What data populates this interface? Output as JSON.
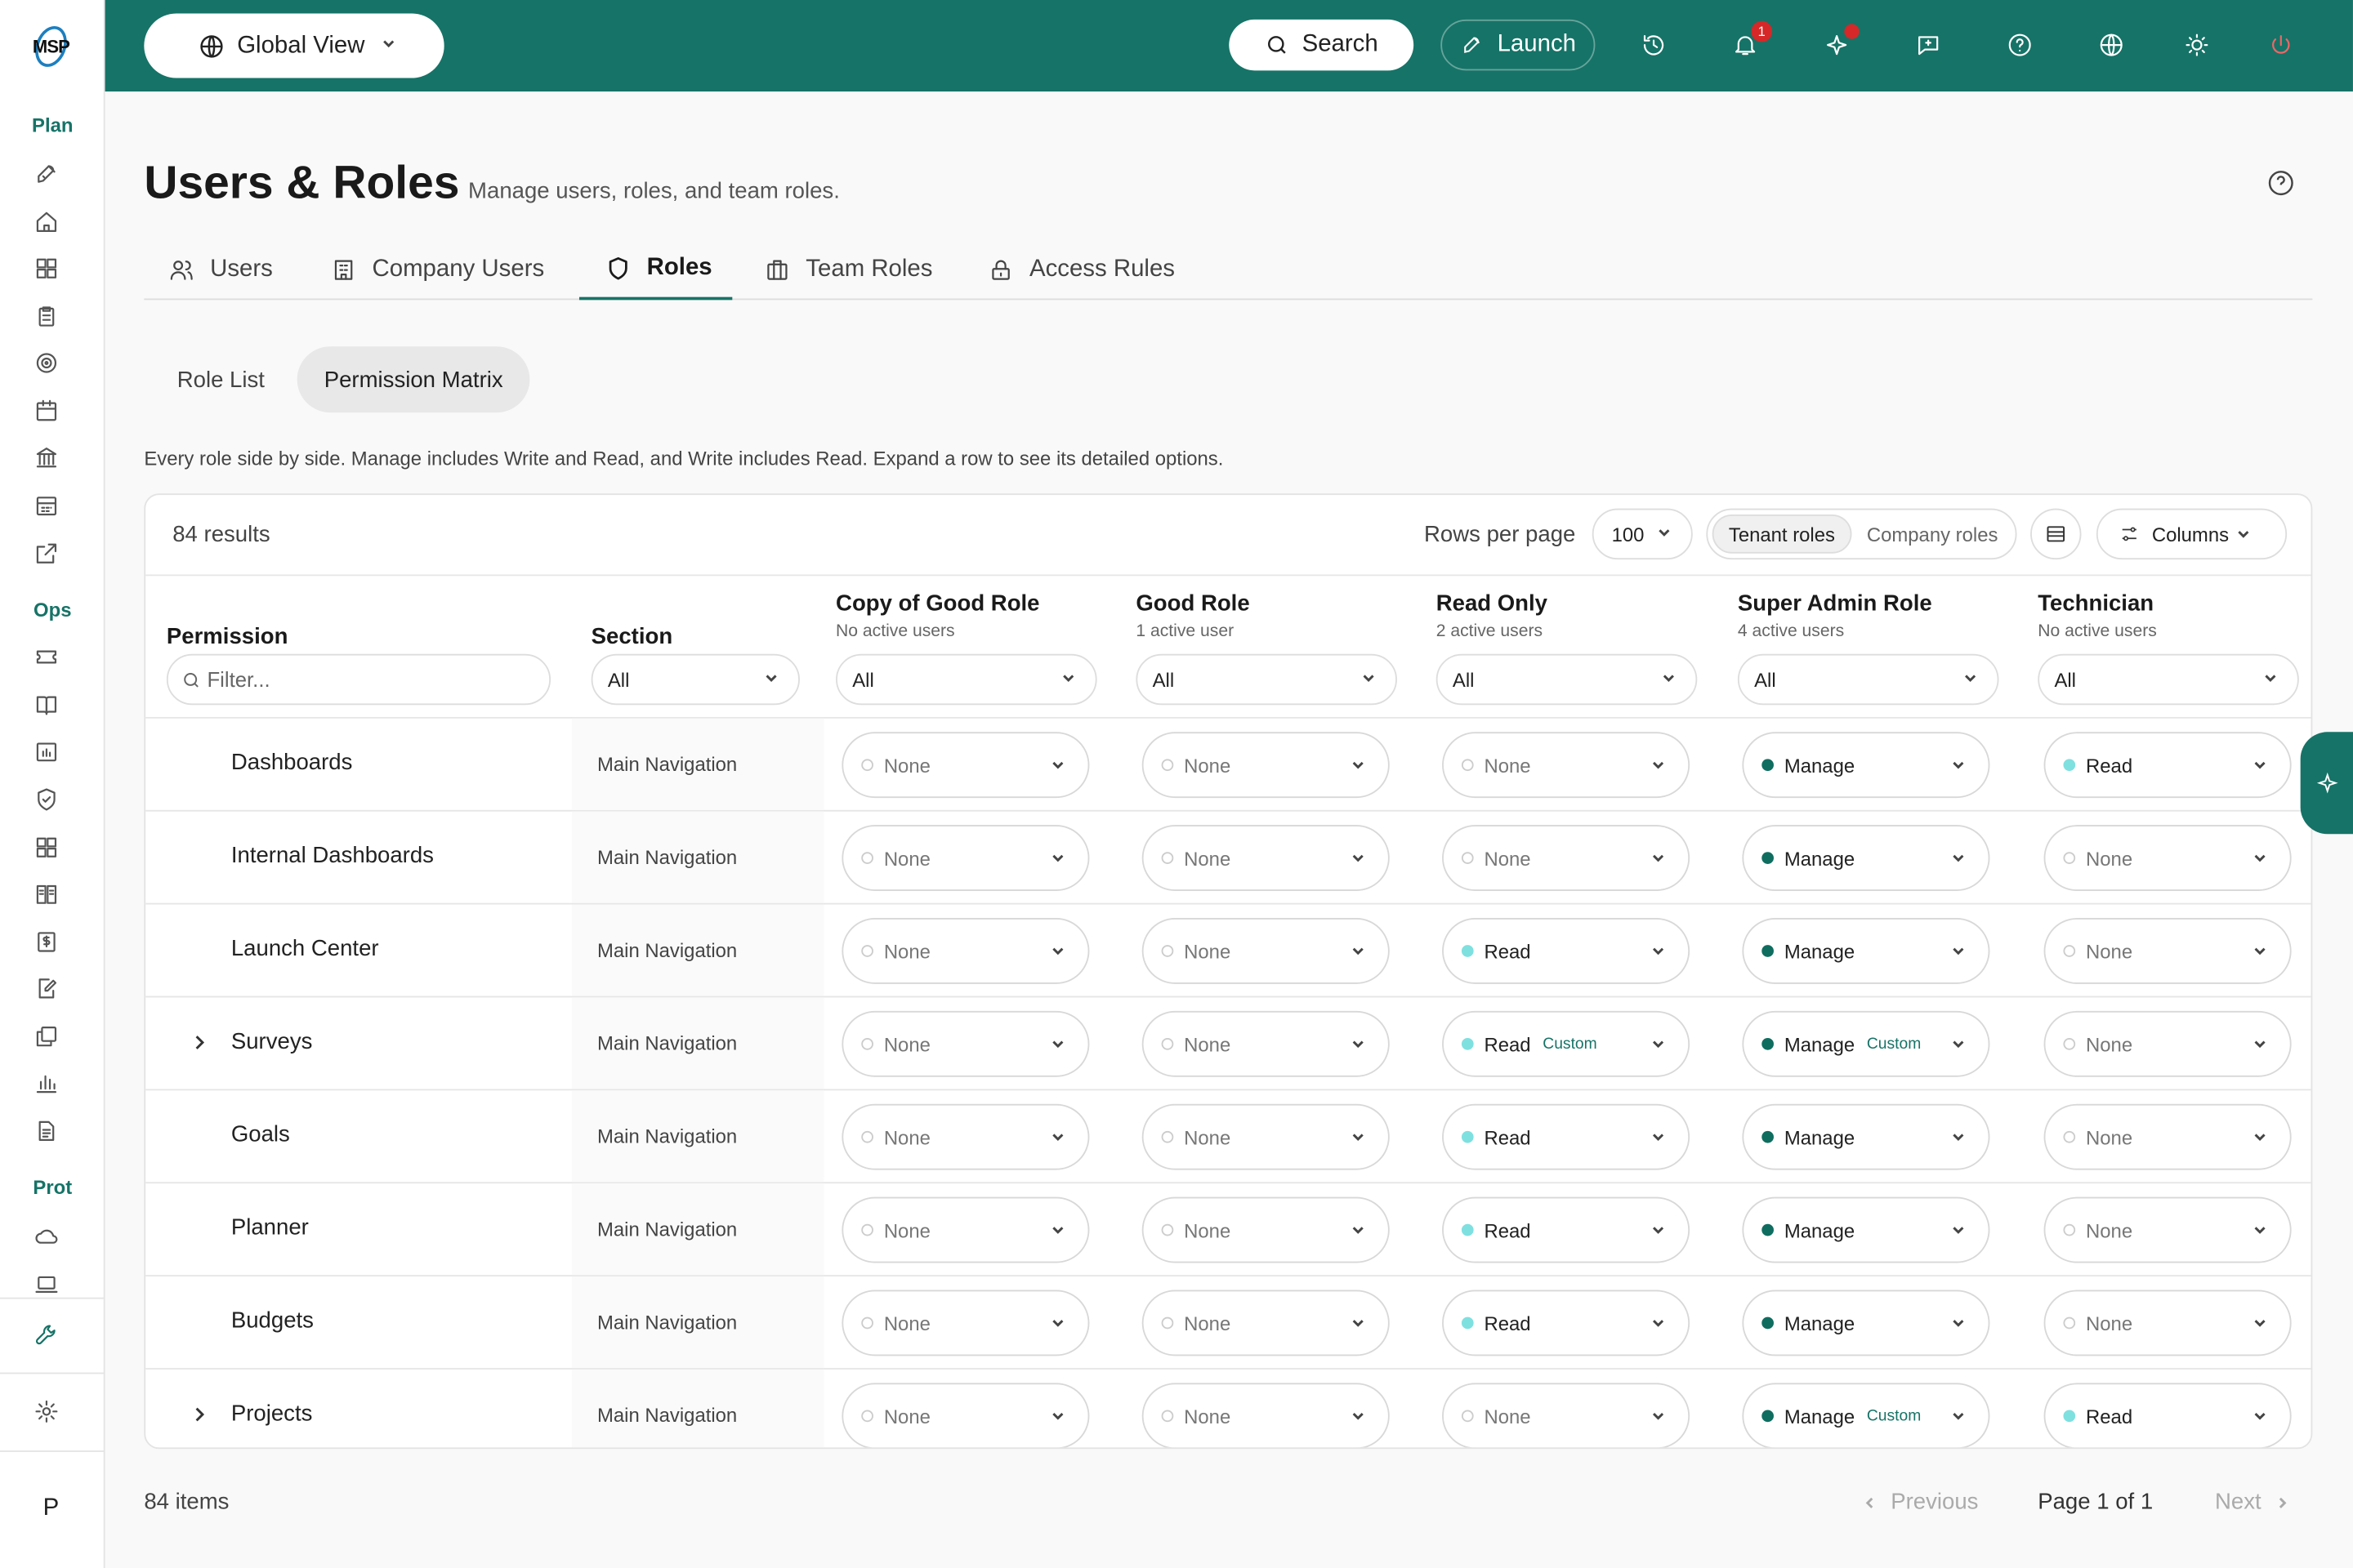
{
  "app": {
    "logo_text": "MSP",
    "global_view_label": "Global View",
    "search_label": "Search",
    "launch_label": "Launch",
    "notification_count": "1"
  },
  "sidebar": {
    "sections": [
      "Plan",
      "Ops",
      "Prot"
    ],
    "avatar_initial": "P",
    "icons": [
      "rocket-icon",
      "home-icon",
      "dashboard-icon",
      "clipboard-icon",
      "target-icon",
      "calendar-icon",
      "bank-icon",
      "schedule-icon",
      "external-link-icon",
      "ticket-icon",
      "book-icon",
      "chart-folder-icon",
      "shield-check-icon",
      "grid-icon",
      "knowledge-icon",
      "billing-icon",
      "edit-doc-icon",
      "copy-icon",
      "bar-chart-icon",
      "document-icon",
      "cloud-icon",
      "laptop-icon",
      "wrench-icon",
      "settings-icon"
    ]
  },
  "page": {
    "title": "Users & Roles",
    "subtitle": "Manage users, roles, and team roles.",
    "description": "Every role side by side. Manage includes Write and Read, and Write includes Read. Expand a row to see its detailed options."
  },
  "tabs": [
    {
      "label": "Users",
      "icon": "users-icon"
    },
    {
      "label": "Company Users",
      "icon": "building-icon"
    },
    {
      "label": "Roles",
      "icon": "shield-icon",
      "active": true
    },
    {
      "label": "Team Roles",
      "icon": "briefcase-icon"
    },
    {
      "label": "Access Rules",
      "icon": "lock-icon"
    }
  ],
  "subtabs": {
    "role_list": "Role List",
    "permission_matrix": "Permission Matrix"
  },
  "toolbar": {
    "results": "84 results",
    "rows_per_page_label": "Rows per page",
    "rows_per_page_value": "100",
    "tenant_roles": "Tenant roles",
    "company_roles": "Company roles",
    "columns_label": "Columns"
  },
  "header": {
    "permission": "Permission",
    "section": "Section",
    "filter_placeholder": "Filter...",
    "section_filter": "All",
    "roles": [
      {
        "name": "Copy of Good Role",
        "users": "No active users",
        "filter": "All"
      },
      {
        "name": "Good Role",
        "users": "1 active user",
        "filter": "All"
      },
      {
        "name": "Read Only",
        "users": "2 active users",
        "filter": "All"
      },
      {
        "name": "Super Admin Role",
        "users": "4 active users",
        "filter": "All"
      },
      {
        "name": "Technician",
        "users": "No active users",
        "filter": "All"
      }
    ]
  },
  "rows": [
    {
      "permission": "Dashboards",
      "section": "Main Navigation",
      "expandable": false,
      "levels": [
        [
          "None",
          ""
        ],
        [
          "None",
          ""
        ],
        [
          "None",
          ""
        ],
        [
          "Manage",
          ""
        ],
        [
          "Read",
          ""
        ]
      ]
    },
    {
      "permission": "Internal Dashboards",
      "section": "Main Navigation",
      "expandable": false,
      "levels": [
        [
          "None",
          ""
        ],
        [
          "None",
          ""
        ],
        [
          "None",
          ""
        ],
        [
          "Manage",
          ""
        ],
        [
          "None",
          ""
        ]
      ]
    },
    {
      "permission": "Launch Center",
      "section": "Main Navigation",
      "expandable": false,
      "levels": [
        [
          "None",
          ""
        ],
        [
          "None",
          ""
        ],
        [
          "Read",
          ""
        ],
        [
          "Manage",
          ""
        ],
        [
          "None",
          ""
        ]
      ]
    },
    {
      "permission": "Surveys",
      "section": "Main Navigation",
      "expandable": true,
      "levels": [
        [
          "None",
          ""
        ],
        [
          "None",
          ""
        ],
        [
          "Read",
          "Custom"
        ],
        [
          "Manage",
          "Custom"
        ],
        [
          "None",
          ""
        ]
      ]
    },
    {
      "permission": "Goals",
      "section": "Main Navigation",
      "expandable": false,
      "levels": [
        [
          "None",
          ""
        ],
        [
          "None",
          ""
        ],
        [
          "Read",
          ""
        ],
        [
          "Manage",
          ""
        ],
        [
          "None",
          ""
        ]
      ]
    },
    {
      "permission": "Planner",
      "section": "Main Navigation",
      "expandable": false,
      "levels": [
        [
          "None",
          ""
        ],
        [
          "None",
          ""
        ],
        [
          "Read",
          ""
        ],
        [
          "Manage",
          ""
        ],
        [
          "None",
          ""
        ]
      ]
    },
    {
      "permission": "Budgets",
      "section": "Main Navigation",
      "expandable": false,
      "levels": [
        [
          "None",
          ""
        ],
        [
          "None",
          ""
        ],
        [
          "Read",
          ""
        ],
        [
          "Manage",
          ""
        ],
        [
          "None",
          ""
        ]
      ]
    },
    {
      "permission": "Projects",
      "section": "Main Navigation",
      "expandable": true,
      "levels": [
        [
          "None",
          ""
        ],
        [
          "None",
          ""
        ],
        [
          "None",
          ""
        ],
        [
          "Manage",
          "Custom"
        ],
        [
          "Read",
          ""
        ]
      ]
    }
  ],
  "footer": {
    "items": "84 items",
    "previous": "Previous",
    "page": "Page 1 of 1",
    "next": "Next"
  }
}
